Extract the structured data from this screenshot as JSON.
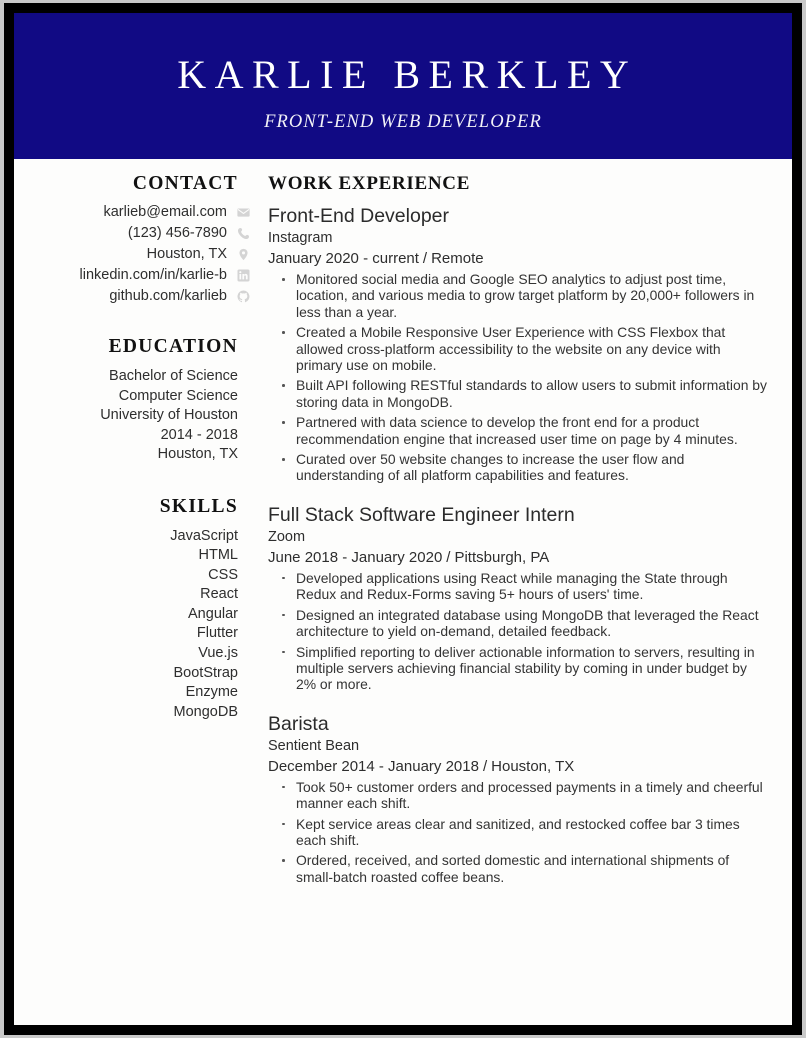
{
  "header": {
    "name": "KARLIE BERKLEY",
    "subtitle": "FRONT-END WEB DEVELOPER",
    "background_color": "#110a84",
    "text_color": "#ffffff"
  },
  "sidebar": {
    "contact": {
      "heading": "CONTACT",
      "items": [
        {
          "text": "karlieb@email.com",
          "icon": "envelope-icon"
        },
        {
          "text": "(123) 456-7890",
          "icon": "phone-icon"
        },
        {
          "text": "Houston, TX",
          "icon": "location-pin-icon"
        },
        {
          "text": "linkedin.com/in/karlie-b",
          "icon": "linkedin-icon"
        },
        {
          "text": "github.com/karlieb",
          "icon": "github-icon"
        }
      ]
    },
    "education": {
      "heading": "EDUCATION",
      "lines": [
        "Bachelor of Science",
        "Computer Science",
        "University of Houston",
        "2014 - 2018",
        "Houston, TX"
      ]
    },
    "skills": {
      "heading": "SKILLS",
      "items": [
        "JavaScript",
        "HTML",
        "CSS",
        "React",
        "Angular",
        "Flutter",
        "Vue.js",
        "BootStrap",
        "Enzyme",
        "MongoDB"
      ]
    }
  },
  "main": {
    "work": {
      "heading": "WORK EXPERIENCE",
      "jobs": [
        {
          "title": "Front-End Developer",
          "company": "Instagram",
          "dates": "January 2020 - current",
          "separator": "/",
          "location": "Remote",
          "bullets": [
            "Monitored social media and Google SEO analytics to adjust post time, location, and various media to grow target platform by 20,000+ followers in less than a year.",
            "Created a Mobile Responsive User Experience with CSS Flexbox that allowed cross-platform accessibility to the website on any device with primary use on mobile.",
            "Built API following RESTful standards to allow users to submit information by storing data in MongoDB.",
            "Partnered with data science to develop the front end for a product recommendation engine that increased user time on page by 4 minutes.",
            "Curated over 50 website changes to increase the user flow and understanding of all platform capabilities and features."
          ]
        },
        {
          "title": "Full Stack Software Engineer Intern",
          "company": "Zoom",
          "dates": "June 2018 - January 2020",
          "separator": "/",
          "location": "Pittsburgh, PA",
          "bullets": [
            "Developed applications using React while managing the State through Redux and Redux-Forms saving 5+ hours of users' time.",
            "Designed an integrated database using MongoDB that leveraged the React architecture to yield on-demand, detailed feedback.",
            "Simplified reporting to deliver actionable information to servers, resulting in multiple servers achieving financial stability by coming in under budget by 2% or more."
          ]
        },
        {
          "title": "Barista",
          "company": "Sentient Bean",
          "dates": "December 2014 - January 2018",
          "separator": "/",
          "location": "Houston, TX",
          "bullets": [
            "Took 50+ customer orders and processed payments in a timely and cheerful manner each shift.",
            "Kept service areas clear and sanitized, and restocked coffee bar 3 times each shift.",
            "Ordered, received, and sorted domestic and international shipments of small-batch roasted coffee beans."
          ]
        }
      ]
    }
  }
}
